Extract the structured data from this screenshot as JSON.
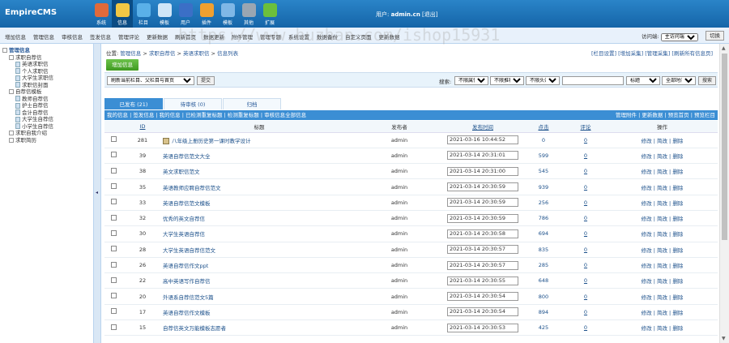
{
  "header": {
    "logo_main": "Empire",
    "logo_sub": "CMS",
    "nav": [
      {
        "label": "系统",
        "icon": "system-icon",
        "color": "#e06a3b"
      },
      {
        "label": "信息",
        "icon": "info-icon",
        "color": "#f2c744",
        "active": true
      },
      {
        "label": "栏目",
        "icon": "column-icon",
        "color": "#5ab0e8"
      },
      {
        "label": "模板",
        "icon": "template-icon",
        "color": "#d0e6f7"
      },
      {
        "label": "用户",
        "icon": "user-icon",
        "color": "#3b6fc6"
      },
      {
        "label": "插件",
        "icon": "plugin-icon",
        "color": "#f0a030"
      },
      {
        "label": "模板",
        "icon": "theme-icon",
        "color": "#7fb7e6"
      },
      {
        "label": "其他",
        "icon": "gear-icon",
        "color": "#9aa6b2"
      },
      {
        "label": "扩展",
        "icon": "extend-icon",
        "color": "#6cbf3c"
      }
    ],
    "user_label": "用户:",
    "username": "admin.cn",
    "logout": "[退出]"
  },
  "menubar": {
    "items": [
      "增加信息",
      "管理信息",
      "审核信息",
      "签发信息",
      "管理评论",
      "更新数据",
      "刷新首页",
      "数据更新",
      "附件管理",
      "管理专题",
      "系统设置",
      "数据备份",
      "自定义页面",
      "更新数据"
    ],
    "access_label": "访问端:",
    "access_value": "主访问端",
    "switch_label": "切换"
  },
  "watermark": "https://www.huzhan.com/ishop15931",
  "sidebar": {
    "items": [
      {
        "label": "管理信息",
        "level": 0,
        "root": true
      },
      {
        "label": "求职自荐信",
        "level": 1
      },
      {
        "label": "英语求职信",
        "level": 2
      },
      {
        "label": "个人求职信",
        "level": 2
      },
      {
        "label": "大学生求职信",
        "level": 2
      },
      {
        "label": "求职信封面",
        "level": 2
      },
      {
        "label": "自荐信模板",
        "level": 1
      },
      {
        "label": "教师自荐信",
        "level": 2
      },
      {
        "label": "护士自荐信",
        "level": 2
      },
      {
        "label": "会计自荐信",
        "level": 2
      },
      {
        "label": "大学生自荐信",
        "level": 2
      },
      {
        "label": "小学生自荐信",
        "level": 2
      },
      {
        "label": "求职自我介绍",
        "level": 1
      },
      {
        "label": "求职简历",
        "level": 1
      }
    ]
  },
  "main": {
    "location": {
      "label": "位置:",
      "crumbs": [
        "管理信息",
        "求职自荐信",
        "英语求职信",
        "信息列表"
      ]
    },
    "toplinks": "[栏目设置] [增加采集] [管理采集] [刷新所有信息页]",
    "add_button": "增加信息",
    "filter": {
      "column_select": "刷新当前栏目、父栏目与首页",
      "submit": "提交",
      "search_label": "搜索:",
      "opt1": "不限属性",
      "opt2": "不限推荐",
      "opt3": "不限头条",
      "search_value": "",
      "field": "标题",
      "time": "全部时间",
      "search_button": "搜索"
    },
    "tabs": [
      "已发布 (21)",
      "待审核 (0)",
      "归档"
    ],
    "subbar_left": "我的信息 | 签发信息 | 我的信息 | 已检测重复标题 | 检测重复标题 | 审核信息全部信息",
    "subbar_right": "管理附件 | 更新数据 | 预览首页 | 预览栏目",
    "columns": {
      "id": "ID",
      "title": "标题",
      "publisher": "发布者",
      "time": "发布时间",
      "clicks": "点击",
      "comments": "评论",
      "ops": "操作"
    },
    "rows": [
      {
        "id": "281",
        "title": "八年级上册历史第一课时教学设计",
        "publisher": "admin",
        "time": "2021-03-16 10:44:52",
        "clicks": "0",
        "comments": "0",
        "icon": true
      },
      {
        "id": "39",
        "title": "英语自荐信范文大全",
        "publisher": "admin",
        "time": "2021-03-14 20:31:01",
        "clicks": "599",
        "comments": "0"
      },
      {
        "id": "38",
        "title": "英文求职信范文",
        "publisher": "admin",
        "time": "2021-03-14 20:31:00",
        "clicks": "545",
        "comments": "0"
      },
      {
        "id": "35",
        "title": "英语教师应聘自荐信范文",
        "publisher": "admin",
        "time": "2021-03-14 20:30:59",
        "clicks": "939",
        "comments": "0"
      },
      {
        "id": "33",
        "title": "英语自荐信范文模板",
        "publisher": "admin",
        "time": "2021-03-14 20:30:59",
        "clicks": "256",
        "comments": "0"
      },
      {
        "id": "32",
        "title": "优秀的英文自荐信",
        "publisher": "admin",
        "time": "2021-03-14 20:30:59",
        "clicks": "786",
        "comments": "0"
      },
      {
        "id": "30",
        "title": "大学生英语自荐信",
        "publisher": "admin",
        "time": "2021-03-14 20:30:58",
        "clicks": "694",
        "comments": "0"
      },
      {
        "id": "28",
        "title": "大学生英语自荐信范文",
        "publisher": "admin",
        "time": "2021-03-14 20:30:57",
        "clicks": "835",
        "comments": "0"
      },
      {
        "id": "26",
        "title": "英语自荐信作文ppt",
        "publisher": "admin",
        "time": "2021-03-14 20:30:57",
        "clicks": "285",
        "comments": "0"
      },
      {
        "id": "22",
        "title": "高中英语写作自荐信",
        "publisher": "admin",
        "time": "2021-03-14 20:30:55",
        "clicks": "648",
        "comments": "0"
      },
      {
        "id": "20",
        "title": "外语系自荐信范文5篇",
        "publisher": "admin",
        "time": "2021-03-14 20:30:54",
        "clicks": "800",
        "comments": "0"
      },
      {
        "id": "17",
        "title": "英语自荐信作文模板",
        "publisher": "admin",
        "time": "2021-03-14 20:30:54",
        "clicks": "894",
        "comments": "0"
      },
      {
        "id": "15",
        "title": "自荐信英文万能模板志愿者",
        "publisher": "admin",
        "time": "2021-03-14 20:30:53",
        "clicks": "425",
        "comments": "0"
      }
    ],
    "row_actions": "修改 | 简改 | 删除"
  }
}
